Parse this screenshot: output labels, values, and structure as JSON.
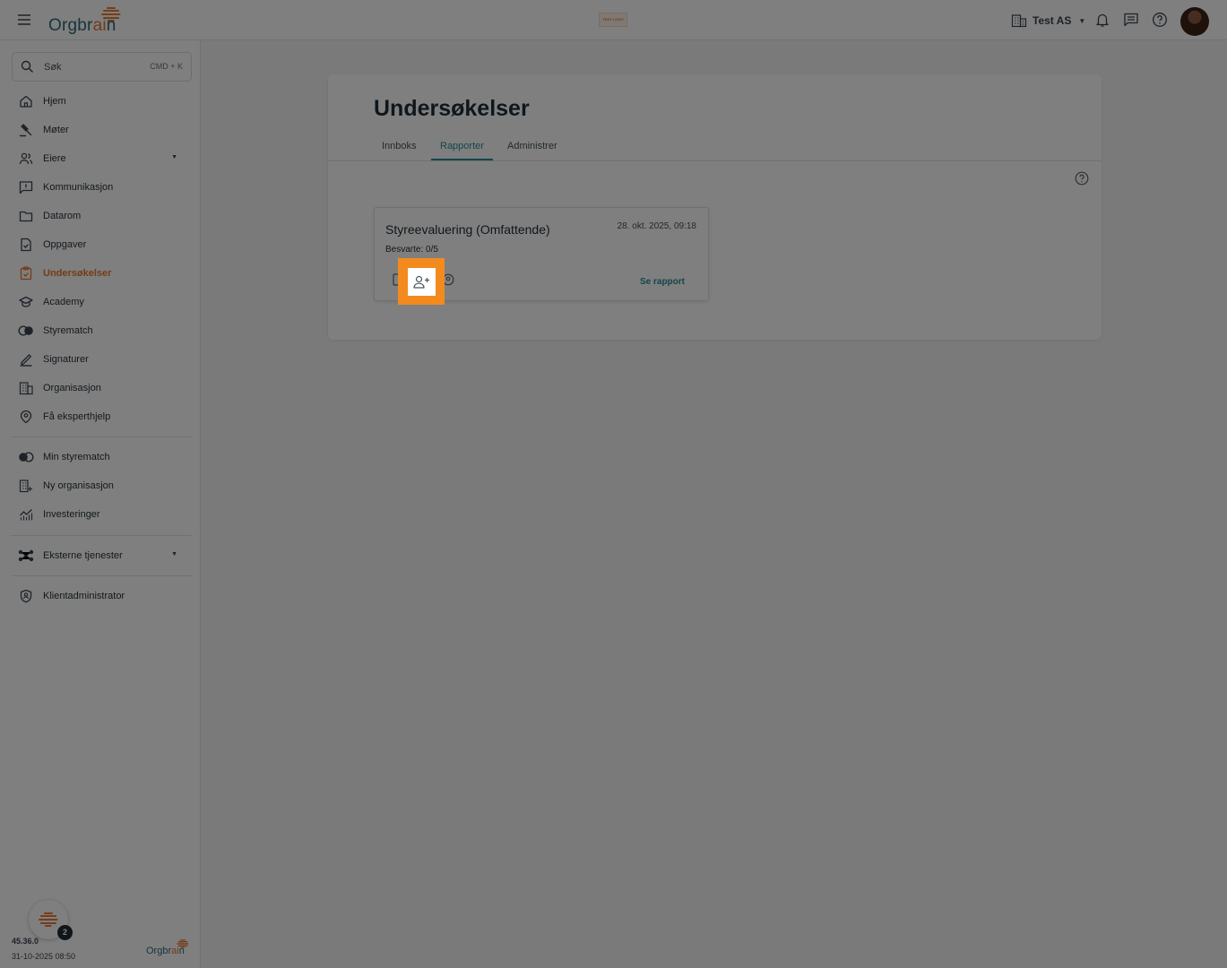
{
  "app": {
    "logo_text_pre": "Orgbr",
    "logo_text_ai": "ai",
    "logo_text_post": "n",
    "test_logo": "TEST LOGO",
    "org_name": "Test AS"
  },
  "sidebar": {
    "search_label": "Søk",
    "search_shortcut": "CMD + K",
    "items": [
      {
        "label": "Hjem"
      },
      {
        "label": "Møter"
      },
      {
        "label": "Eiere"
      },
      {
        "label": "Kommunikasjon"
      },
      {
        "label": "Datarom"
      },
      {
        "label": "Oppgaver"
      },
      {
        "label": "Undersøkelser"
      },
      {
        "label": "Academy"
      },
      {
        "label": "Styrematch"
      },
      {
        "label": "Signaturer"
      },
      {
        "label": "Organisasjon"
      },
      {
        "label": "Få eksperthjelp"
      }
    ],
    "secondary": [
      {
        "label": "Min styrematch"
      },
      {
        "label": "Ny organisasjon"
      },
      {
        "label": "Investeringer"
      }
    ],
    "external": {
      "label": "Eksterne tjenester"
    },
    "admin": {
      "label": "Klientadministrator"
    },
    "version": "45.36.0",
    "build_date": "31-10-2025 08:50",
    "help_badge": "2"
  },
  "main": {
    "title": "Undersøkelser",
    "tabs": [
      {
        "label": "Innboks"
      },
      {
        "label": "Rapporter"
      },
      {
        "label": "Administrer"
      }
    ],
    "active_tab": "Rapporter",
    "survey": {
      "title": "Styreevaluering (Omfattende)",
      "date": "28. okt. 2025, 09:18",
      "answered": "Besvarte: 0/5",
      "see_report": "Se rapport"
    }
  },
  "colors": {
    "accent": "#e8782e",
    "teal": "#2a8a99",
    "highlight": "#f28a1e"
  }
}
